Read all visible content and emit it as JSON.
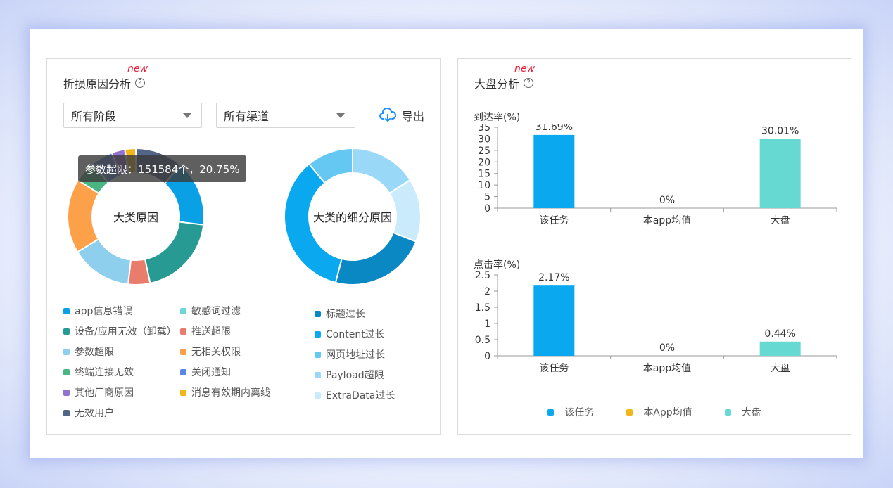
{
  "left_panel": {
    "new_tag": "new",
    "title": "折损原因分析",
    "help_glyph": "?",
    "stage_select": "所有阶段",
    "channel_select": "所有渠道",
    "export_label": "导出",
    "tooltip": "参数超限：151584个，20.75%",
    "donut1_center": "大类原因",
    "donut2_center": "大类的细分原因",
    "legend_left": [
      {
        "label": "app信息错误",
        "color": "#0aa0e6"
      },
      {
        "label": "敏感词过滤",
        "color": "#6ed7d6"
      },
      {
        "label": "设备/应用无效（卸载）",
        "color": "#269a93"
      },
      {
        "label": "推送超限",
        "color": "#ea7c6b"
      },
      {
        "label": "参数超限",
        "color": "#8dcfed"
      },
      {
        "label": "无相关权限",
        "color": "#fca14a"
      },
      {
        "label": "终端连接无效",
        "color": "#49b583"
      },
      {
        "label": "关闭通知",
        "color": "#5b86e8"
      },
      {
        "label": "其他厂商原因",
        "color": "#9372cf"
      },
      {
        "label": "消息有效期内离线",
        "color": "#f1b619"
      },
      {
        "label": "无效用户",
        "color": "#516586"
      }
    ],
    "legend_right": [
      {
        "label": "标题过长",
        "color": "#0a88c4"
      },
      {
        "label": "Content过长",
        "color": "#0aa8ee"
      },
      {
        "label": "网页地址过长",
        "color": "#64c8f2"
      },
      {
        "label": "Payload超限",
        "color": "#99d9f7"
      },
      {
        "label": "ExtraData过长",
        "color": "#c9ebfb"
      }
    ]
  },
  "right_panel": {
    "new_tag": "new",
    "title": "大盘分析",
    "help_glyph": "?",
    "legend": [
      {
        "label": "该任务",
        "color": "#0aa8ee"
      },
      {
        "label": "本App均值",
        "color": "#f1b619"
      },
      {
        "label": "大盘",
        "color": "#66d9d3"
      }
    ]
  },
  "chart_data": [
    {
      "type": "pie",
      "title": "大类原因",
      "categories": [
        "无效用户",
        "app信息错误",
        "设备/应用无效（卸载）",
        "推送超限",
        "参数超限",
        "无相关权限",
        "终端连接无效",
        "关闭通知",
        "其他厂商原因",
        "消息有效期内离线"
      ],
      "values": [
        11,
        15,
        19,
        5,
        14,
        17,
        5,
        5,
        3,
        2.5
      ],
      "colors": [
        "#516586",
        "#0aa0e6",
        "#269a93",
        "#ea7c6b",
        "#8dcfed",
        "#fca14a",
        "#49b583",
        "#5b86e8",
        "#9372cf",
        "#f1b619"
      ]
    },
    {
      "type": "pie",
      "title": "大类的细分原因",
      "categories": [
        "Payload超限",
        "ExtraData过长",
        "标题过长",
        "Content过长",
        "网页地址过长"
      ],
      "values": [
        16,
        15,
        23,
        35,
        11
      ],
      "colors": [
        "#99d9f7",
        "#c9ebfb",
        "#0a88c4",
        "#0aa8ee",
        "#64c8f2"
      ]
    },
    {
      "type": "bar",
      "title": "到达率(%)",
      "categories": [
        "该任务",
        "本app均值",
        "大盘"
      ],
      "values": [
        31.69,
        0,
        30.01
      ],
      "value_labels": [
        "31.69%",
        "0%",
        "30.01%"
      ],
      "yticks": [
        "0",
        "5",
        "10",
        "15",
        "20",
        "25",
        "30",
        "35"
      ],
      "ylim": [
        0,
        35
      ],
      "colors": [
        "#0aa8ee",
        "#f1b619",
        "#66d9d3"
      ]
    },
    {
      "type": "bar",
      "title": "点击率(%)",
      "categories": [
        "该任务",
        "本app均值",
        "大盘"
      ],
      "values": [
        2.17,
        0,
        0.44
      ],
      "value_labels": [
        "2.17%",
        "0%",
        "0.44%"
      ],
      "yticks": [
        "0",
        "0.5",
        "1",
        "1.5",
        "2",
        "2.5"
      ],
      "ylim": [
        0,
        2.5
      ],
      "colors": [
        "#0aa8ee",
        "#f1b619",
        "#66d9d3"
      ]
    }
  ]
}
